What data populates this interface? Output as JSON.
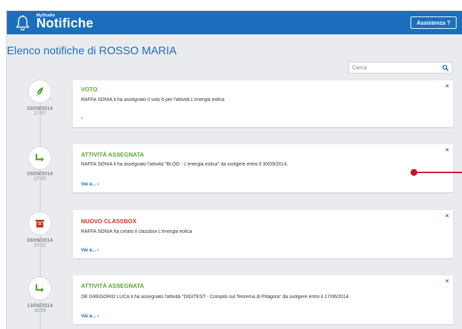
{
  "header": {
    "brand_small": "MyStudio",
    "title": "Notifiche",
    "help_label": "Assistenza ?"
  },
  "page": {
    "title": "Elenco notifiche di ROSSO MARIA"
  },
  "search": {
    "placeholder": "Cerca"
  },
  "notifications": [
    {
      "icon": "feather-icon",
      "date": "03/09/2014",
      "time": "17:57",
      "title": "VOTO",
      "color": "#5aa431",
      "body": "RAFFA SONIA ti ha assegnato il voto 6 per l'attività L'energia eolica",
      "link": "›"
    },
    {
      "icon": "arrow-turn-right-icon",
      "date": "03/09/2014",
      "time": "17:25",
      "title": "ATTIVITÀ ASSEGNATA",
      "color": "#5aa431",
      "body": "RAFFA SONIA ti ha assegnato l'attività \"BLOG - L'energia eolica\" da svolgere entro il 30/09/2014.",
      "link": "Vai a... ›"
    },
    {
      "icon": "archive-box-icon",
      "date": "03/09/2014",
      "time": "17:12",
      "title": "NUOVO CLASSBOX",
      "color": "#c0392b",
      "body": "RAFFA SONIA ha creato il classbox L'energia eolica",
      "link": "Vai a... ›"
    },
    {
      "icon": "arrow-turn-right-icon",
      "date": "13/06/2014",
      "time": "16:59",
      "title": "ATTIVITÀ ASSEGNATA",
      "color": "#5aa431",
      "body": "DE GREGORIO LUCA ti ha assegnato l'attività \"DIGITEST - Compito sul Teorema di Pitagora\" da svolgere entro il 17/06/2014.",
      "link": "Vai a... ›"
    }
  ],
  "close_label": "×"
}
